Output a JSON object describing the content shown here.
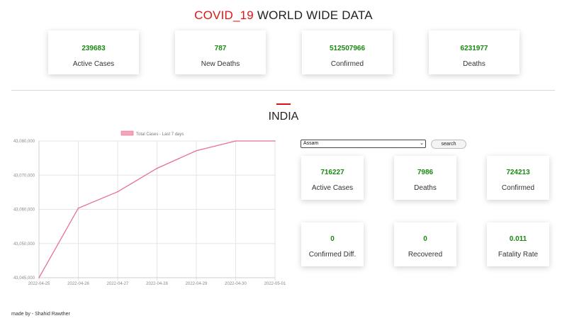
{
  "header": {
    "title_red": "COVID_19",
    "title_black": " WORLD WIDE DATA"
  },
  "world_stats": [
    {
      "value": "239683",
      "label": "Active Cases"
    },
    {
      "value": "787",
      "label": "New Deaths"
    },
    {
      "value": "512507966",
      "label": "Confirmed"
    },
    {
      "value": "6231977",
      "label": "Deaths"
    }
  ],
  "country": {
    "name": "INDIA"
  },
  "chart_data": {
    "type": "line",
    "legend": "Total Cases - Last 7 days",
    "legend_color": "#f4a6b8",
    "line_color": "#e87090",
    "x": [
      "2022-04-25",
      "2022-04-26",
      "2022-04-27",
      "2022-04-28",
      "2022-04-29",
      "2022-04-30",
      "2022-05-01"
    ],
    "values": [
      43045000,
      43062800,
      43067000,
      43073000,
      43077500,
      43082100,
      43085000
    ],
    "ylim": [
      43045000,
      43080000
    ],
    "yticks": [
      43045000,
      43050000,
      43060000,
      43070000,
      43080000
    ],
    "ytick_labels": [
      "43,045,000",
      "43,050,000",
      "43,060,000",
      "43,070,000",
      "43,080,000"
    ],
    "grid": true
  },
  "state_filter": {
    "selected": "Assam",
    "search_label": "search"
  },
  "state_stats": [
    {
      "value": "716227",
      "label": "Active Cases"
    },
    {
      "value": "7986",
      "label": "Deaths"
    },
    {
      "value": "724213",
      "label": "Confirmed"
    },
    {
      "value": "0",
      "label": "Confirmed Diff."
    },
    {
      "value": "0",
      "label": "Recovered"
    },
    {
      "value": "0.011",
      "label": "Fatality Rate"
    }
  ],
  "footer": {
    "text": "made by - Shahid Rawther"
  }
}
